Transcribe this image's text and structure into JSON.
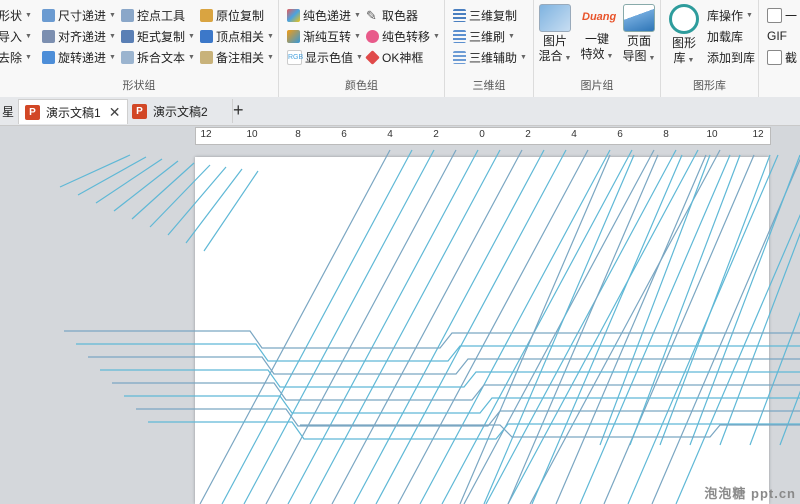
{
  "ribbon": {
    "groups": [
      {
        "label": "形状组",
        "items": [
          {
            "text": "形状",
            "dd": true
          },
          {
            "text": "导入",
            "dd": true
          },
          {
            "text": "去除",
            "dd": true
          },
          {
            "text": "尺寸递进",
            "dd": true
          },
          {
            "text": "对齐递进",
            "dd": true
          },
          {
            "text": "旋转递进",
            "dd": true
          },
          {
            "text": "控点工具",
            "dd": false
          },
          {
            "text": "矩式复制",
            "dd": true
          },
          {
            "text": "拆合文本",
            "dd": true
          },
          {
            "text": "原位复制",
            "dd": false
          },
          {
            "text": "顶点相关",
            "dd": true
          },
          {
            "text": "备注相关",
            "dd": true
          }
        ]
      },
      {
        "label": "颜色组",
        "items": [
          {
            "text": "纯色递进",
            "dd": true
          },
          {
            "text": "渐纯互转",
            "dd": true
          },
          {
            "text": "显示色值",
            "dd": true
          },
          {
            "text": "取色器",
            "dd": false
          },
          {
            "text": "纯色转移",
            "dd": true
          },
          {
            "text": "OK神框",
            "dd": false
          }
        ]
      },
      {
        "label": "三维组",
        "items": [
          {
            "text": "三维复制",
            "dd": false
          },
          {
            "text": "三维刷",
            "dd": true
          },
          {
            "text": "三维辅助",
            "dd": true
          }
        ]
      },
      {
        "label": "图片组",
        "big": [
          {
            "line1": "图片",
            "line2": "混合",
            "dd": true
          },
          {
            "line1": "一键",
            "line2": "特效",
            "dd": true,
            "badge": "Duang"
          },
          {
            "line1": "页面",
            "line2": "导图",
            "dd": true
          }
        ]
      },
      {
        "label": "图形库",
        "big": [
          {
            "line1": "图形",
            "line2": "库",
            "dd": true
          }
        ],
        "items": [
          {
            "text": "库操作",
            "dd": true
          },
          {
            "text": "加载库",
            "dd": false
          },
          {
            "text": "添加到库",
            "dd": false
          }
        ]
      },
      {
        "label": "",
        "items": [
          {
            "text": "一",
            "dd": false
          },
          {
            "text": "GIF",
            "dd": false
          },
          {
            "text": "截",
            "dd": false
          }
        ]
      }
    ]
  },
  "tabs": [
    {
      "label": "演示文稿1",
      "active": true
    },
    {
      "label": "演示文稿2",
      "active": false
    }
  ],
  "tab_prefix": "星",
  "add_tab": "+",
  "ruler_labels": [
    "12",
    "10",
    "8",
    "6",
    "4",
    "2",
    "0",
    "2",
    "4",
    "6",
    "8",
    "10",
    "12"
  ],
  "watermark": "泡泡糖 ppt.cn",
  "colors": {
    "line_blue": "#5fb8d6",
    "line_gray": "#7aa6c2",
    "ribbon_bg": "#f8f8f8",
    "ppt_icon": "#d24726"
  }
}
